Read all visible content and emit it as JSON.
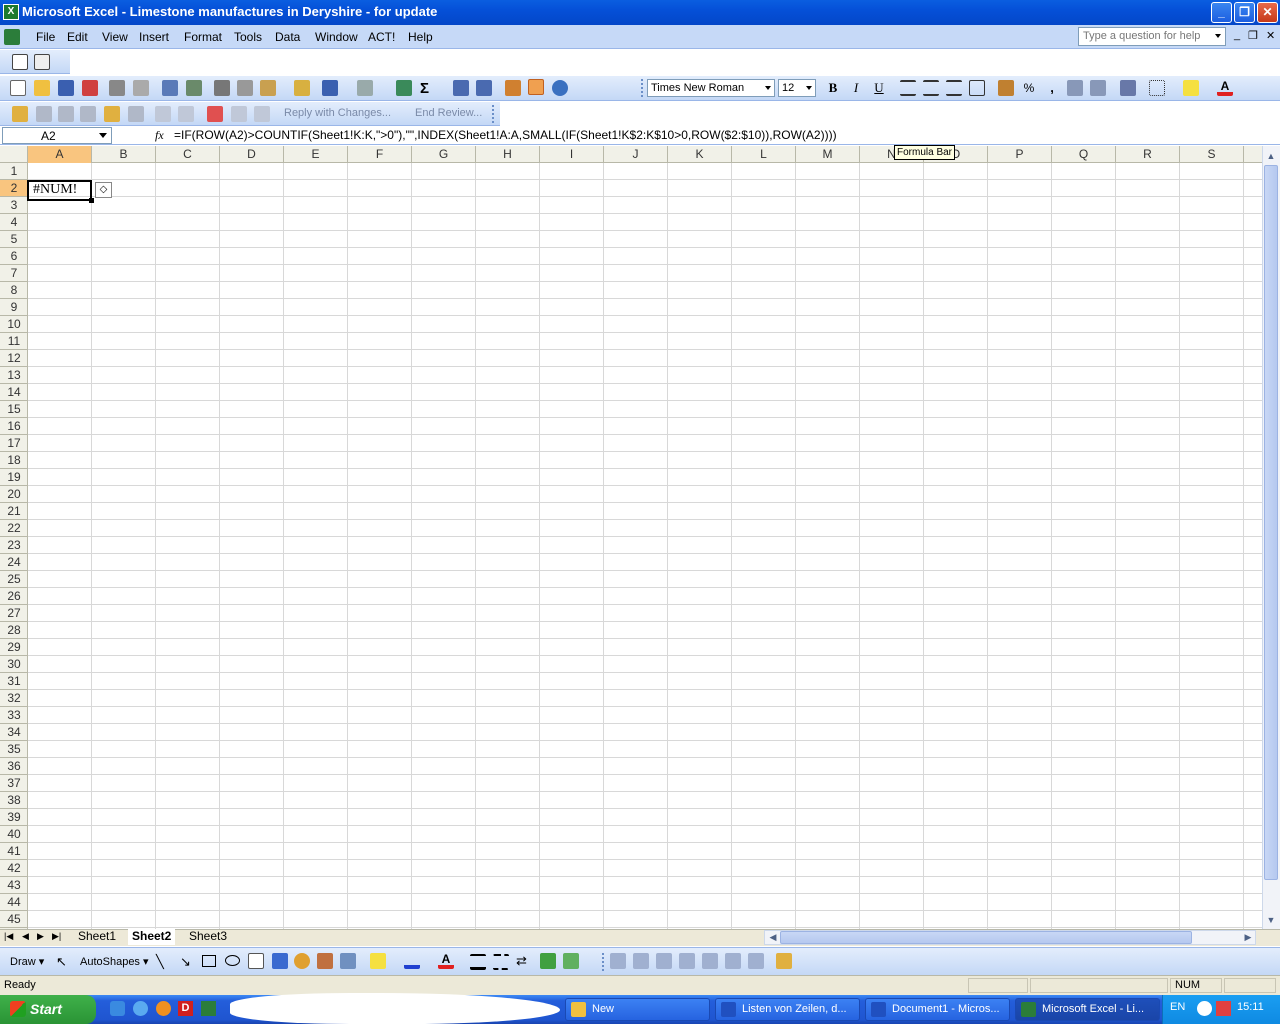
{
  "window": {
    "title": "Microsoft Excel - Limestone manufactures in Deryshire -  for update"
  },
  "menu": [
    "File",
    "Edit",
    "View",
    "Insert",
    "Format",
    "Tools",
    "Data",
    "Window",
    "ACT!",
    "Help"
  ],
  "help_box_placeholder": "Type a question for help",
  "toolbar": {
    "font": "Times New Roman",
    "size": "12",
    "bold": "B",
    "italic": "I",
    "underline": "U",
    "percent": "%",
    "comma": ","
  },
  "review_toolbar": {
    "reply": "Reply with Changes...",
    "end_review": "End Review..."
  },
  "formula_bar": {
    "name_box": "A2",
    "fx": "fx",
    "formula": "=IF(ROW(A2)>COUNTIF(Sheet1!K:K,\">0\"),\"\",INDEX(Sheet1!A:A,SMALL(IF(Sheet1!K$2:K$10>0,ROW($2:$10)),ROW(A2))))",
    "tooltip": "Formula Bar"
  },
  "columns": [
    "A",
    "B",
    "C",
    "D",
    "E",
    "F",
    "G",
    "H",
    "I",
    "J",
    "K",
    "L",
    "M",
    "N",
    "O",
    "P",
    "Q",
    "R",
    "S"
  ],
  "active_cell": {
    "ref": "A2",
    "value": "#NUM!"
  },
  "sheets": {
    "tabs": [
      "Sheet1",
      "Sheet2",
      "Sheet3"
    ],
    "active": "Sheet2"
  },
  "draw_toolbar": {
    "draw": "Draw",
    "autoshapes": "AutoShapes"
  },
  "status": {
    "left": "Ready",
    "num": "NUM"
  },
  "taskbar": {
    "start": "Start",
    "tasks": [
      "New",
      "Listen von Zeilen, d...",
      "Document1 - Micros...",
      "Microsoft Excel - Li..."
    ],
    "active_task": "Microsoft Excel - Li...",
    "lang": "EN",
    "clock": "15:11"
  },
  "colors": {
    "titlebar": "#0550d8",
    "selected_header": "#f9c57f",
    "taskbar": "#245edb",
    "start": "#2a9435"
  }
}
